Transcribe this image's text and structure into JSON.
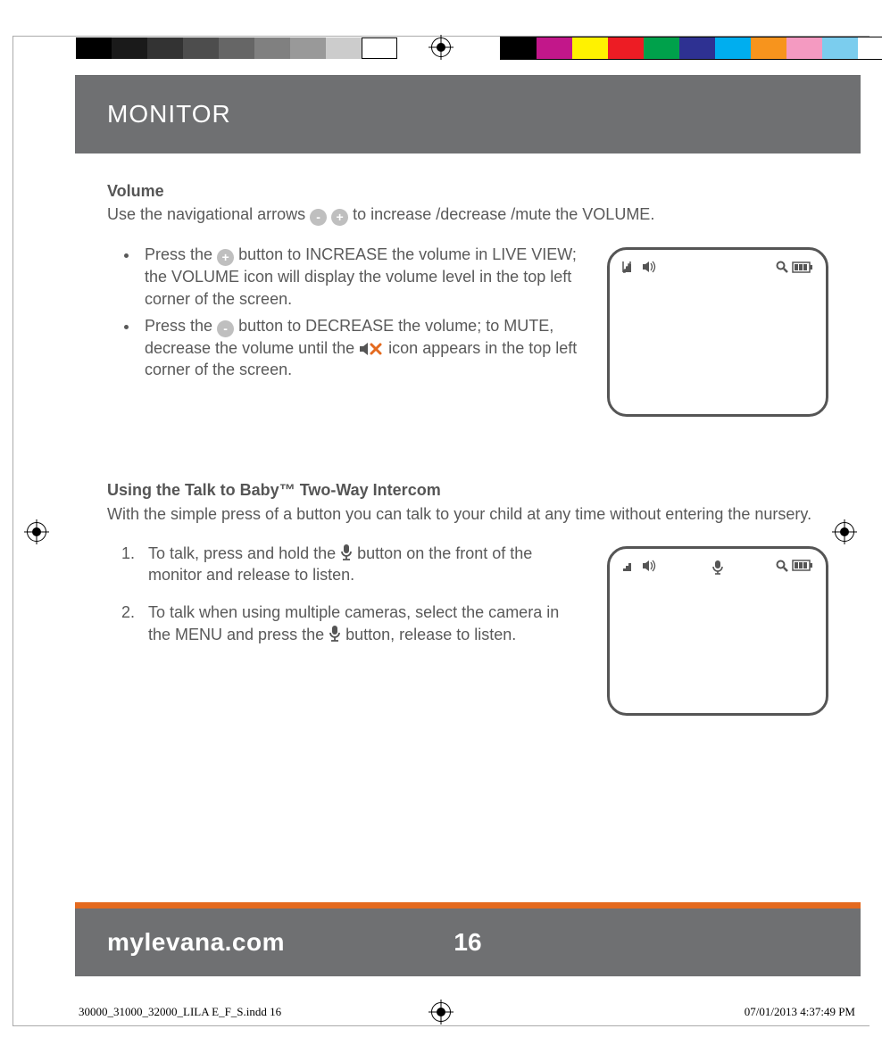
{
  "header": {
    "title": "MONITOR"
  },
  "volume": {
    "heading": "Volume",
    "intro_pre": "Use the navigational arrows ",
    "intro_post": " to increase /decrease /mute the VOLUME.",
    "bullet1_a": "Press the ",
    "bullet1_b": " button to INCREASE the volume in LIVE VIEW; the VOLUME icon will display the volume level in the top left corner of the screen.",
    "bullet2_a": "Press the ",
    "bullet2_b": " button to DECREASE the volume; to MUTE, decrease the volume until the ",
    "bullet2_c": " icon appears in the top left corner of the screen."
  },
  "intercom": {
    "heading": "Using the Talk to Baby™ Two-Way Intercom",
    "intro": "With the simple press of a button you can talk to your child at any time without entering the nursery.",
    "step1_a": "To talk, press and hold the ",
    "step1_b": " button on the front of the monitor and release to listen.",
    "step2_a": "To talk when using multiple cameras, select the camera in the MENU and press the ",
    "step2_b": " button, release to listen."
  },
  "footer": {
    "site": "mylevana.com",
    "page": "16"
  },
  "slug": {
    "file": "30000_31000_32000_LILA E_F_S.indd   16",
    "stamp": "07/01/2013   4:37:49 PM"
  },
  "colors": {
    "accent": "#e46a1f",
    "bar": "#6f7072"
  }
}
